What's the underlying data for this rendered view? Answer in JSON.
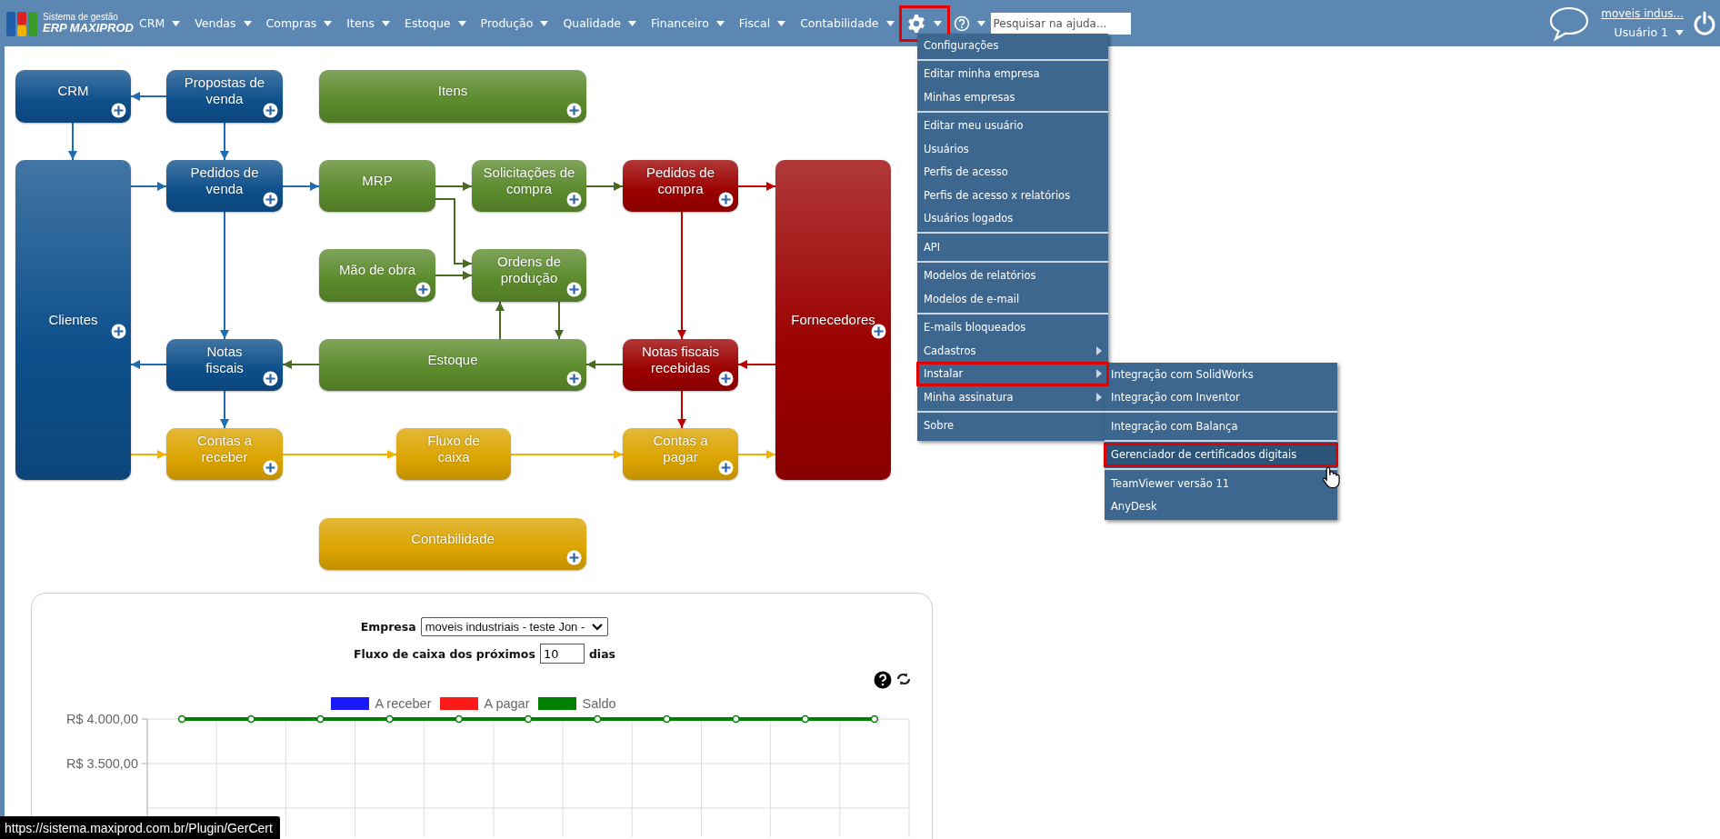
{
  "header": {
    "logo": {
      "subtitle": "Sistema de gestão",
      "title": "ERP MAXIPROD"
    },
    "nav": [
      "CRM",
      "Vendas",
      "Compras",
      "Itens",
      "Estoque",
      "Produção",
      "Qualidade",
      "Financeiro",
      "Fiscal",
      "Contabilidade"
    ],
    "settings_button": {
      "highlighted": true
    },
    "search": {
      "placeholder": "Pesquisar na ajuda..."
    },
    "account": {
      "company_link": "moveis indus...",
      "user": "Usuário 1"
    }
  },
  "settings_menu": {
    "groups": [
      [
        {
          "label": "Configurações",
          "has_submenu": false,
          "highlighted": false
        }
      ],
      [
        {
          "label": "Editar minha empresa",
          "has_submenu": false,
          "highlighted": false
        },
        {
          "label": "Minhas empresas",
          "has_submenu": false,
          "highlighted": false
        }
      ],
      [
        {
          "label": "Editar meu usuário",
          "has_submenu": false,
          "highlighted": false
        },
        {
          "label": "Usuários",
          "has_submenu": false,
          "highlighted": false
        },
        {
          "label": "Perfis de acesso",
          "has_submenu": false,
          "highlighted": false
        },
        {
          "label": "Perfis de acesso x relatórios",
          "has_submenu": false,
          "highlighted": false
        },
        {
          "label": "Usuários logados",
          "has_submenu": false,
          "highlighted": false
        }
      ],
      [
        {
          "label": "API",
          "has_submenu": false,
          "highlighted": false
        }
      ],
      [
        {
          "label": "Modelos de relatórios",
          "has_submenu": false,
          "highlighted": false
        },
        {
          "label": "Modelos de e-mail",
          "has_submenu": false,
          "highlighted": false
        }
      ],
      [
        {
          "label": "E-mails bloqueados",
          "has_submenu": false,
          "highlighted": false
        },
        {
          "label": "Cadastros",
          "has_submenu": true,
          "highlighted": false
        },
        {
          "label": "Instalar",
          "has_submenu": true,
          "highlighted": true
        },
        {
          "label": "Minha assinatura",
          "has_submenu": true,
          "highlighted": false
        }
      ],
      [
        {
          "label": "Sobre",
          "has_submenu": false,
          "highlighted": false
        }
      ]
    ]
  },
  "install_submenu": {
    "groups": [
      [
        {
          "label": "Integração com SolidWorks",
          "selected": false,
          "highlighted": false
        },
        {
          "label": "Integração com Inventor",
          "selected": false,
          "highlighted": false
        }
      ],
      [
        {
          "label": "Integração com Balança",
          "selected": false,
          "highlighted": false
        }
      ],
      [
        {
          "label": "Gerenciador de certificados digitais",
          "selected": true,
          "highlighted": true
        }
      ],
      [
        {
          "label": "TeamViewer versão 11",
          "selected": false,
          "highlighted": false
        },
        {
          "label": "AnyDesk",
          "selected": false,
          "highlighted": false
        }
      ]
    ]
  },
  "flow_diagram": {
    "nodes": [
      {
        "label": "CRM",
        "color": "#0d4f8b",
        "has_add_button": true
      },
      {
        "label": "Propostas de\nvenda",
        "color": "#0d4f8b",
        "has_add_button": true
      },
      {
        "label": "Itens",
        "color": "#5b8a2c",
        "has_add_button": true
      },
      {
        "label": "Clientes",
        "color": "#0d4f8b",
        "has_add_button": true
      },
      {
        "label": "Pedidos de\nvenda",
        "color": "#0d4f8b",
        "has_add_button": true
      },
      {
        "label": "MRP",
        "color": "#5b8a2c",
        "has_add_button": false
      },
      {
        "label": "Solicitações de\ncompra",
        "color": "#5b8a2c",
        "has_add_button": true
      },
      {
        "label": "Pedidos de\ncompra",
        "color": "#9b0000",
        "has_add_button": true
      },
      {
        "label": "Fornecedores",
        "color": "#9b0000",
        "has_add_button": true
      },
      {
        "label": "Mão de obra",
        "color": "#5b8a2c",
        "has_add_button": true
      },
      {
        "label": "Ordens de\nprodução",
        "color": "#5b8a2c",
        "has_add_button": true
      },
      {
        "label": "Notas\nfiscais",
        "color": "#0d4f8b",
        "has_add_button": true
      },
      {
        "label": "Estoque",
        "color": "#5b8a2c",
        "has_add_button": true
      },
      {
        "label": "Notas fiscais\nrecebidas",
        "color": "#9b0000",
        "has_add_button": true
      },
      {
        "label": "Contas a\nreceber",
        "color": "#dca400",
        "has_add_button": true
      },
      {
        "label": "Fluxo de\ncaixa",
        "color": "#dca400",
        "has_add_button": false
      },
      {
        "label": "Contas a\npagar",
        "color": "#dca400",
        "has_add_button": true
      },
      {
        "label": "Contabilidade",
        "color": "#dca400",
        "has_add_button": true
      }
    ],
    "connections": [
      {
        "color": "#1f6db3"
      },
      {
        "color": "#1f6db3"
      },
      {
        "color": "#1f6db3"
      },
      {
        "color": "#1f6db3"
      },
      {
        "color": "#1f6db3"
      },
      {
        "color": "#1f6db3"
      },
      {
        "color": "#1f6db3"
      },
      {
        "color": "#1f6db3"
      },
      {
        "color": "#4a6b22"
      },
      {
        "color": "#4a6b22"
      },
      {
        "color": "#4a6b22"
      },
      {
        "color": "#4a6b22"
      },
      {
        "color": "#4a6b22"
      },
      {
        "color": "#4a6b22"
      },
      {
        "color": "#4a6b22"
      },
      {
        "color": "#c00000"
      },
      {
        "color": "#c00000"
      },
      {
        "color": "#c00000"
      },
      {
        "color": "#4a6b22"
      },
      {
        "color": "#c00000"
      },
      {
        "color": "#f0b400"
      },
      {
        "color": "#f0b400"
      },
      {
        "color": "#f0b400"
      },
      {
        "color": "#f0b400"
      }
    ]
  },
  "cash_flow": {
    "company_label": "Empresa",
    "company_value": "moveis industriais - teste Jon -",
    "days_label": "Fluxo de caixa dos próximos",
    "days_value": "10",
    "days_unit": "dias",
    "chart": {
      "y_axis_labels": [
        "R$ 4.000,00",
        "R$ 3.500,00"
      ],
      "series": [
        {
          "name": "A receber",
          "color": "#1a1aff",
          "kind": "hidden"
        },
        {
          "name": "A pagar",
          "color": "#ff1a1a",
          "kind": "hidden"
        },
        {
          "name": "Saldo",
          "color": "#008000",
          "kind": "flat-line"
        }
      ]
    }
  },
  "status_url": "https://sistema.maxiprod.com.br/Plugin/GerCert"
}
